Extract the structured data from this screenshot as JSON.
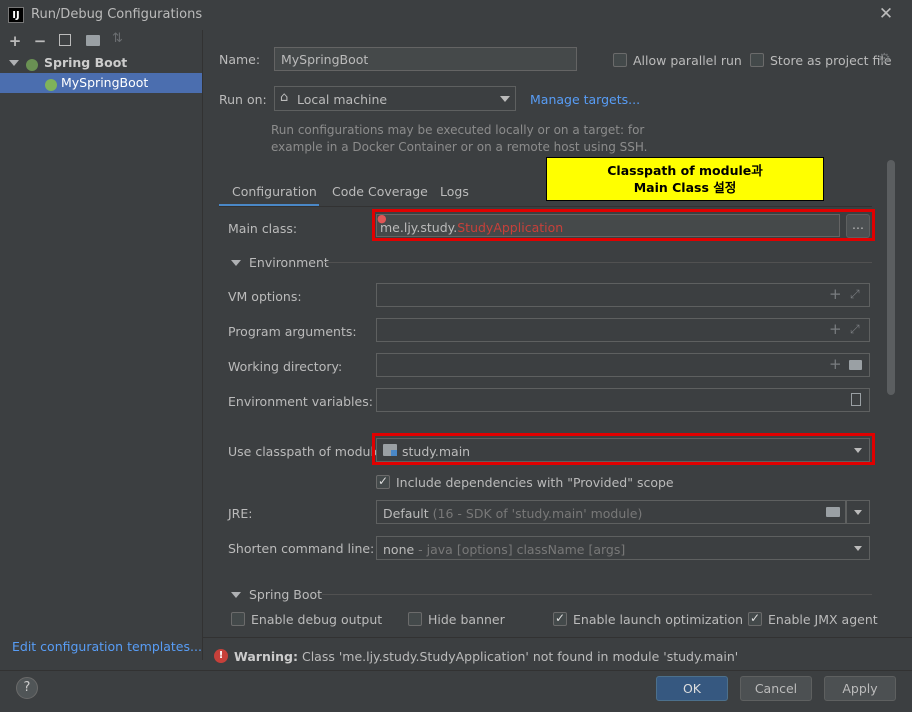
{
  "window": {
    "title": "Run/Debug Configurations",
    "app_icon": "IJ"
  },
  "toolbar": {
    "icons": [
      "+",
      "−",
      "⧉",
      "▣",
      "⇵"
    ]
  },
  "tree": {
    "group": "Spring Boot",
    "item": "MySpringBoot"
  },
  "left_footer": {
    "edit_templates": "Edit configuration templates..."
  },
  "form": {
    "name_label": "Name:",
    "name_value": "MySpringBoot",
    "allow_parallel": "Allow parallel run",
    "store_project_file": "Store as project file",
    "run_on_label": "Run on:",
    "run_on_value": "Local machine",
    "manage_targets": "Manage targets...",
    "run_on_help_line1": "Run configurations may be executed locally or on a target: for",
    "run_on_help_line2": "example in a Docker Container or on a remote host using SSH."
  },
  "tabs": [
    "Configuration",
    "Code Coverage",
    "Logs"
  ],
  "annotation": {
    "line1": "Classpath of module과",
    "line2": "Main Class 설정"
  },
  "config": {
    "main_class_label": "Main class:",
    "main_class_prefix": "me.ljy.study.",
    "main_class_suffix": "StudyApplication",
    "browse": "...",
    "environment": "Environment",
    "vm_options": "VM options:",
    "program_arguments": "Program arguments:",
    "working_directory": "Working directory:",
    "environment_variables": "Environment variables:",
    "classpath_label": "Use classpath of module:",
    "classpath_value": "study.main",
    "include_dependencies": "Include dependencies with \"Provided\" scope",
    "jre_label": "JRE:",
    "jre_value": "Default",
    "jre_detail": "(16 - SDK of 'study.main' module)",
    "shorten_label": "Shorten command line:",
    "shorten_value": "none",
    "shorten_detail": "- java [options] className [args]",
    "spring_boot": "Spring Boot",
    "enable_debug": "Enable debug output",
    "hide_banner": "Hide banner",
    "enable_launch": "Enable launch optimization",
    "enable_jmx": "Enable JMX agent"
  },
  "warning": {
    "title": "Warning:",
    "message": "Class 'me.ljy.study.StudyApplication' not found in module 'study.main'"
  },
  "buttons": {
    "help": "?",
    "ok": "OK",
    "cancel": "Cancel",
    "apply": "Apply"
  },
  "colors": {
    "accent": "#4b6eaf",
    "link": "#589df6",
    "error": "#c7403a",
    "highlight": "#ffff00",
    "box": "#e00000"
  }
}
